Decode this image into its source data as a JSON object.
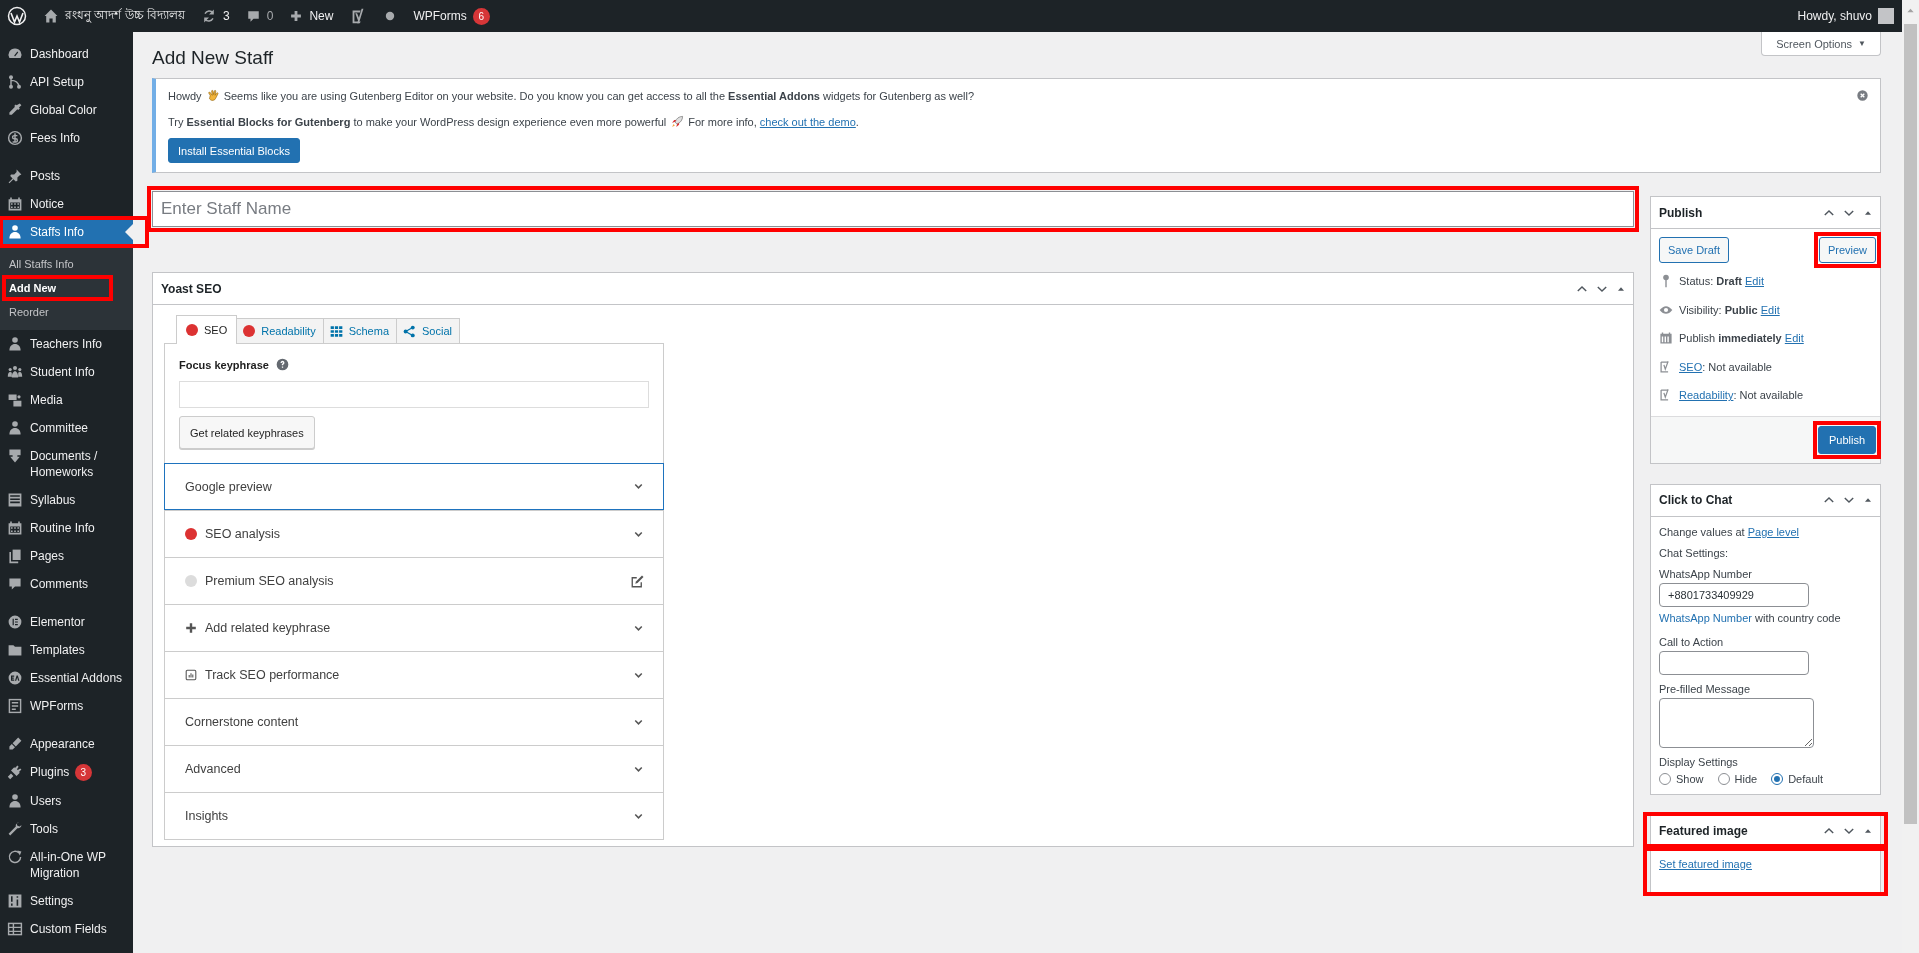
{
  "admin_bar": {
    "site_name": "রংধনু আদর্শ উচ্চ বিদ্যালয়",
    "updates": "3",
    "comments": "0",
    "new_label": "New",
    "wpforms_label": "WPForms",
    "wpforms_badge": "6",
    "greeting": "Howdy, shuvo"
  },
  "sidebar": {
    "groups": [
      {
        "items": [
          {
            "label": "Dashboard",
            "selected": false,
            "highlighted": false
          },
          {
            "label": "API Setup",
            "selected": false,
            "highlighted": false
          },
          {
            "label": "Global Color",
            "selected": false,
            "highlighted": false
          },
          {
            "label": "Fees Info",
            "selected": false,
            "highlighted": false
          }
        ]
      },
      {
        "items": [
          {
            "label": "Posts",
            "selected": false,
            "highlighted": false
          },
          {
            "label": "Notice",
            "selected": false,
            "highlighted": false
          },
          {
            "label": "Staffs Info",
            "selected": true,
            "highlighted": true,
            "submenu": [
              {
                "label": "All Staffs Info",
                "selected": false,
                "highlighted": false
              },
              {
                "label": "Add New",
                "selected": true,
                "highlighted": true
              },
              {
                "label": "Reorder",
                "selected": false,
                "highlighted": false
              }
            ]
          },
          {
            "label": "Teachers Info",
            "selected": false,
            "highlighted": false
          },
          {
            "label": "Student Info",
            "selected": false,
            "highlighted": false
          },
          {
            "label": "Media",
            "selected": false,
            "highlighted": false
          },
          {
            "label": "Committee",
            "selected": false,
            "highlighted": false
          },
          {
            "label": "Documents / Homeworks",
            "selected": false,
            "highlighted": false
          },
          {
            "label": "Syllabus",
            "selected": false,
            "highlighted": false
          },
          {
            "label": "Routine Info",
            "selected": false,
            "highlighted": false
          },
          {
            "label": "Pages",
            "selected": false,
            "highlighted": false
          },
          {
            "label": "Comments",
            "selected": false,
            "highlighted": false
          }
        ]
      },
      {
        "items": [
          {
            "label": "Elementor",
            "selected": false,
            "highlighted": false
          },
          {
            "label": "Templates",
            "selected": false,
            "highlighted": false
          },
          {
            "label": "Essential Addons",
            "selected": false,
            "highlighted": false
          },
          {
            "label": "WPForms",
            "selected": false,
            "highlighted": false
          }
        ]
      },
      {
        "items": [
          {
            "label": "Appearance",
            "selected": false,
            "highlighted": false
          },
          {
            "label": "Plugins",
            "selected": false,
            "highlighted": false,
            "badge": "3"
          },
          {
            "label": "Users",
            "selected": false,
            "highlighted": false
          },
          {
            "label": "Tools",
            "selected": false,
            "highlighted": false
          },
          {
            "label": "All-in-One WP Migration",
            "selected": false,
            "highlighted": false
          },
          {
            "label": "Settings",
            "selected": false,
            "highlighted": false
          },
          {
            "label": "Custom Fields",
            "selected": false,
            "highlighted": false
          }
        ]
      }
    ]
  },
  "page": {
    "title": "Add New Staff",
    "screen_options": "Screen Options",
    "screen_options_caret": "▼"
  },
  "notice": {
    "greeting": "Howdy",
    "line_1": "Seems like you are using Gutenberg Editor on your website. Do you know you can get access to all the **Essential Addons** widgets for Gutenberg as well?",
    "line_2": "Try **Essential Blocks for Gutenberg** to make your WordPress design experience even more powerful",
    "line_2_more": "For more info,",
    "link": "check out the demo",
    "link_after": ".",
    "button": "Install Essential Blocks"
  },
  "title_field": {
    "placeholder": "Enter Staff Name",
    "highlighted": true
  },
  "yoast": {
    "title": "Yoast SEO",
    "tabs": [
      {
        "label": "SEO",
        "kind": "score",
        "color": "#dc3232",
        "selected": true
      },
      {
        "label": "Readability",
        "kind": "score",
        "color": "#dc3232",
        "selected": false
      },
      {
        "label": "Schema",
        "kind": "schema",
        "selected": false
      },
      {
        "label": "Social",
        "kind": "social",
        "selected": false
      }
    ],
    "focus_label": "Focus keyphrase",
    "button": "Get related keyphrases",
    "sections": [
      {
        "label": "Google preview",
        "kind": "plain",
        "focused": true
      },
      {
        "label": "SEO analysis",
        "kind": "score",
        "color": "#dc3232",
        "focused": false
      },
      {
        "label": "Premium SEO analysis",
        "kind": "premium",
        "color": "#dcdcdc",
        "focused": false
      },
      {
        "label": "Add related keyphrase",
        "kind": "add",
        "focused": false
      },
      {
        "label": "Track SEO performance",
        "kind": "track",
        "focused": false
      },
      {
        "label": "Cornerstone content",
        "kind": "plain",
        "focused": false
      },
      {
        "label": "Advanced",
        "kind": "plain",
        "focused": false
      },
      {
        "label": "Insights",
        "kind": "plain",
        "focused": false
      }
    ]
  },
  "publish": {
    "title": "Publish",
    "save_draft": "Save Draft",
    "preview": {
      "label": "Preview",
      "highlighted": true
    },
    "rows": [
      {
        "kind": "status",
        "parts": [
          {
            "text": "Status: **Draft** "
          },
          {
            "link": "Edit"
          }
        ]
      },
      {
        "kind": "visibility",
        "parts": [
          {
            "text": "Visibility: **Public** "
          },
          {
            "link": "Edit"
          }
        ]
      },
      {
        "kind": "schedule",
        "parts": [
          {
            "text": "Publish **immediately** "
          },
          {
            "link": "Edit"
          }
        ]
      },
      {
        "kind": "yoast",
        "parts": [
          {
            "link": "SEO"
          },
          {
            "text": ": Not available"
          }
        ]
      },
      {
        "kind": "yoast",
        "parts": [
          {
            "link": "Readability"
          },
          {
            "text": ": Not available"
          }
        ]
      }
    ],
    "action": {
      "label": "Publish",
      "highlighted": true
    }
  },
  "click_to_chat": {
    "title": "Click to Chat",
    "intro": "Change values at",
    "intro_link": "Page level",
    "settings_label": "Chat Settings:",
    "number_label": "WhatsApp Number",
    "number_value": "+8801733409929",
    "number_hint_link": "WhatsApp Number",
    "number_hint": "with country code",
    "cta_label": "Call to Action",
    "message_label": "Pre-filled Message",
    "display_label": "Display Settings",
    "display_options": [
      {
        "label": "Show",
        "selected": false
      },
      {
        "label": "Hide",
        "selected": false
      },
      {
        "label": "Default",
        "selected": true
      }
    ]
  },
  "featured_image": {
    "title": "Featured image",
    "link": "Set featured image",
    "title_highlighted": true,
    "link_highlighted": true
  }
}
